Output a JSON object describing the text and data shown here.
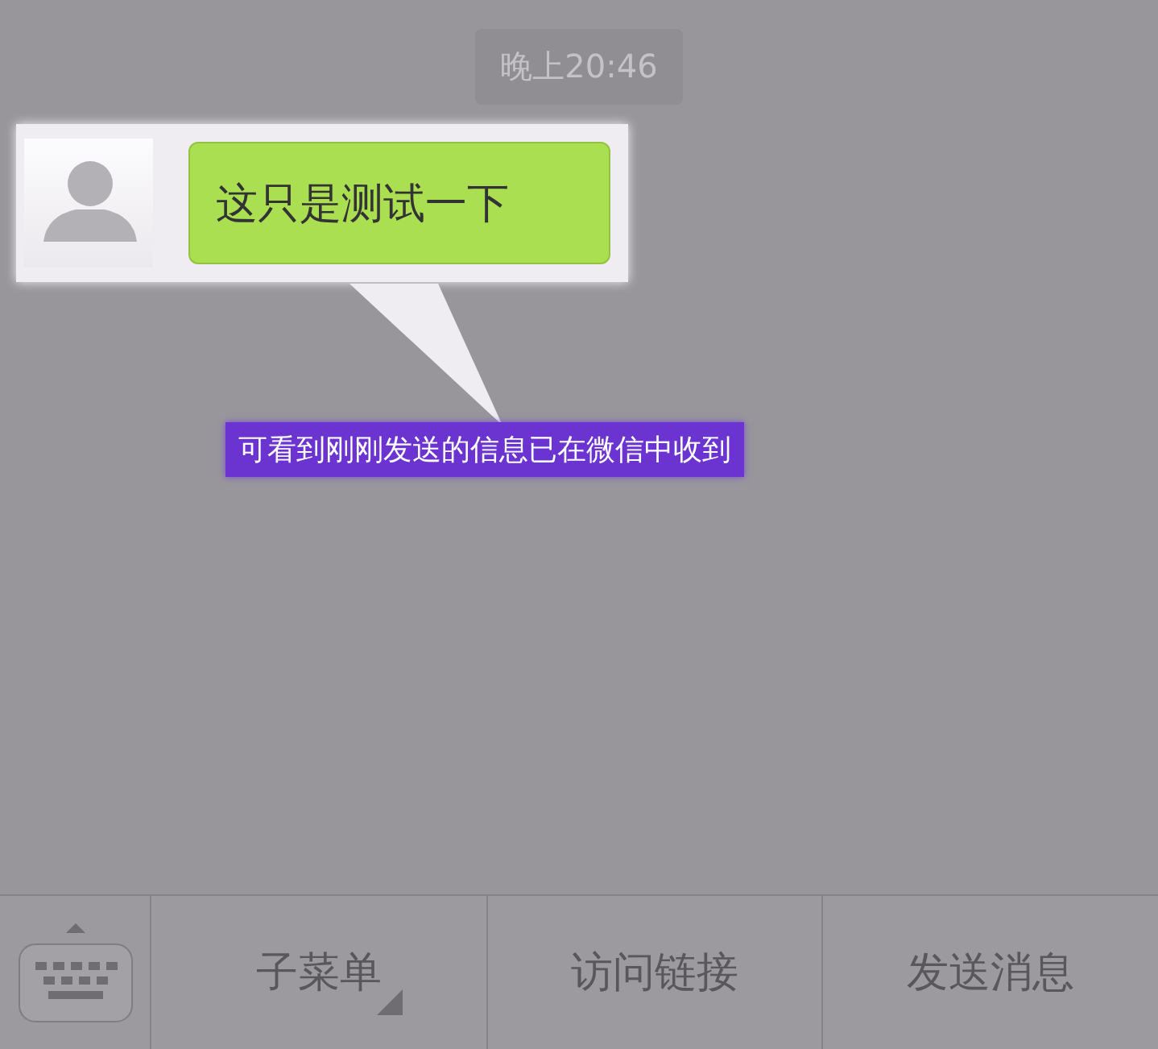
{
  "chat": {
    "time": "晚上20:46",
    "messages": [
      {
        "text": "这只是测试一下"
      }
    ]
  },
  "annotation": {
    "text": "可看到刚刚发送的信息已在微信中收到"
  },
  "menu_bar": {
    "items": [
      {
        "label": "子菜单",
        "submenu": true
      },
      {
        "label": "访问链接",
        "submenu": false
      },
      {
        "label": "发送消息",
        "submenu": false
      }
    ]
  }
}
